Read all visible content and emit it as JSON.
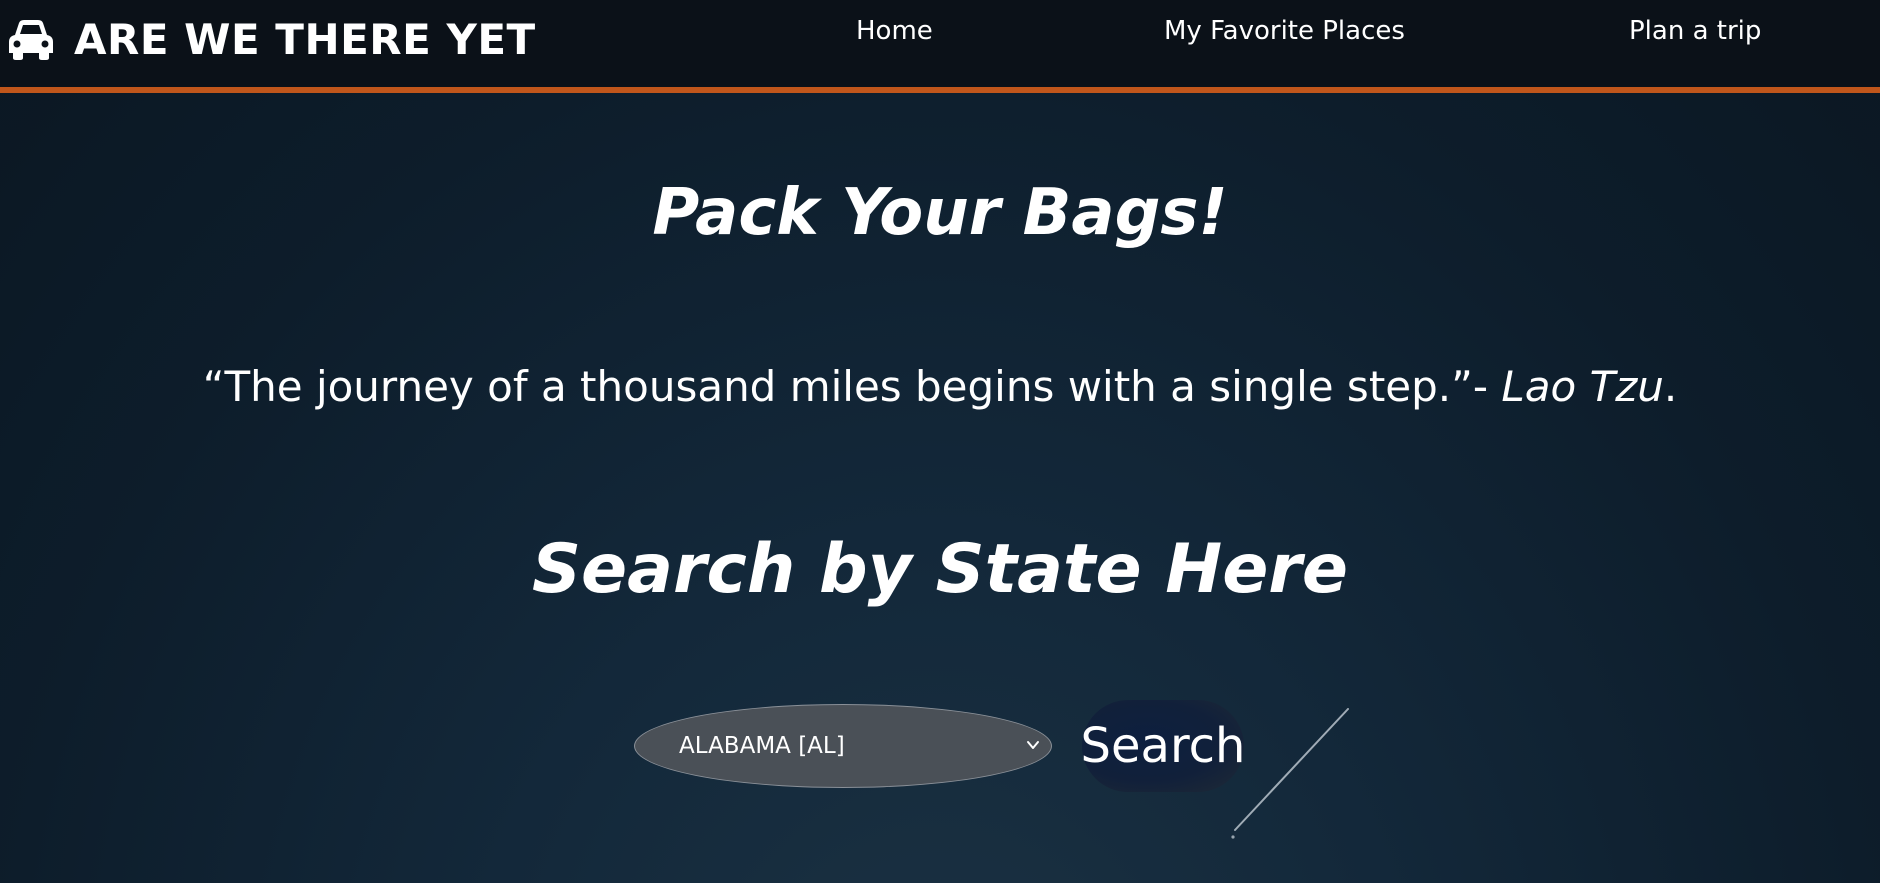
{
  "navbar": {
    "brand_icon": "car-icon",
    "brand_title": "ARE WE THERE YET",
    "links": [
      {
        "label": "Home"
      },
      {
        "label": "My Favorite Places"
      },
      {
        "label": "Plan a trip"
      }
    ]
  },
  "main": {
    "heading": "Pack Your Bags!",
    "quote_text": "“The journey of a thousand miles begins with a single step.”- ",
    "quote_author": "Lao Tzu",
    "quote_end": ".",
    "search_heading": "Search by State Here",
    "state_select": {
      "selected": "ALABAMA [AL]",
      "icon": "chevron-down-icon"
    },
    "search_button": "Search"
  },
  "colors": {
    "navbar_bg": "#0b1118",
    "accent_border": "#c0561b",
    "select_bg": "#4a5057"
  }
}
